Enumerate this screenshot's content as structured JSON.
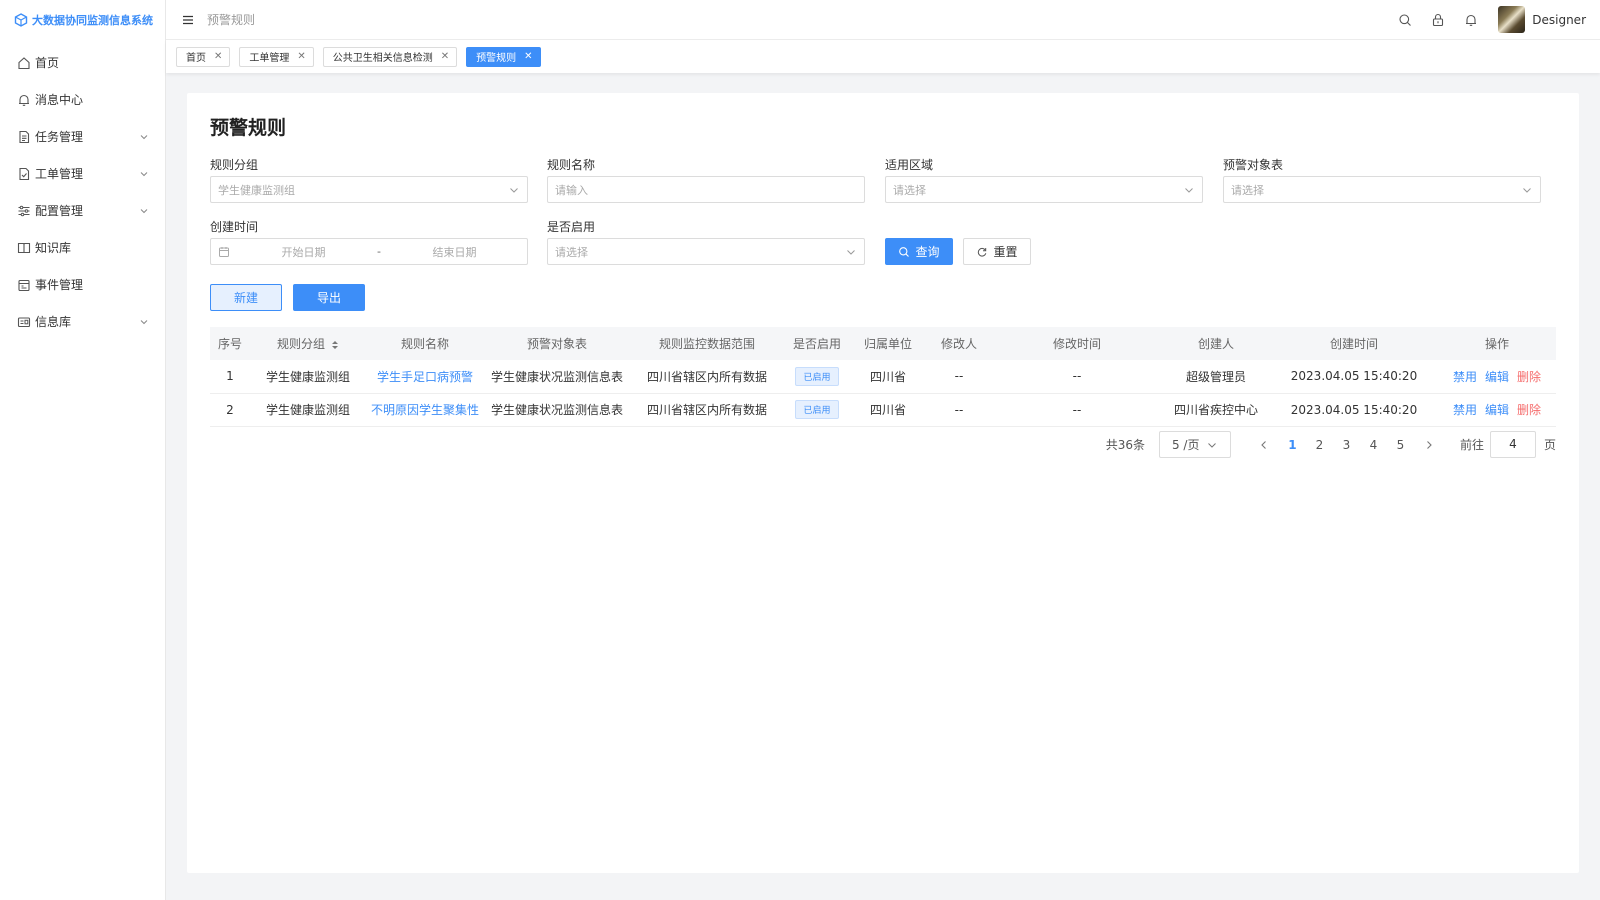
{
  "app": {
    "title": "大数据协同监测信息系统",
    "logo_icon": "cube-icon"
  },
  "sidebar": {
    "items": [
      {
        "label": "首页",
        "icon": "home-icon",
        "expandable": false
      },
      {
        "label": "消息中心",
        "icon": "bell-icon",
        "expandable": false
      },
      {
        "label": "任务管理",
        "icon": "document-icon",
        "expandable": true
      },
      {
        "label": "工单管理",
        "icon": "document-check-icon",
        "expandable": true
      },
      {
        "label": "配置管理",
        "icon": "sliders-icon",
        "expandable": true
      },
      {
        "label": "知识库",
        "icon": "book-icon",
        "expandable": false
      },
      {
        "label": "事件管理",
        "icon": "calendar-icon",
        "expandable": false
      },
      {
        "label": "信息库",
        "icon": "card-icon",
        "expandable": true
      }
    ]
  },
  "header": {
    "breadcrumb": "预警规则",
    "username": "Designer"
  },
  "tabs": [
    {
      "label": "首页",
      "active": false
    },
    {
      "label": "工单管理",
      "active": false
    },
    {
      "label": "公共卫生相关信息检测",
      "active": false
    },
    {
      "label": "预警规则",
      "active": true
    }
  ],
  "page": {
    "title": "预警规则"
  },
  "filters": {
    "group": {
      "label": "规则分组",
      "placeholder": "学生健康监测组"
    },
    "name": {
      "label": "规则名称",
      "placeholder": "请输入"
    },
    "region": {
      "label": "适用区域",
      "placeholder": "请选择"
    },
    "target": {
      "label": "预警对象表",
      "placeholder": "请选择"
    },
    "created": {
      "label": "创建时间",
      "start_placeholder": "开始日期",
      "separator": "-",
      "end_placeholder": "结束日期"
    },
    "enabled": {
      "label": "是否启用",
      "placeholder": "请选择"
    },
    "query_label": "查询",
    "reset_label": "重置"
  },
  "actions": {
    "new_label": "新建",
    "export_label": "导出"
  },
  "table": {
    "headers": [
      "序号",
      "规则分组",
      "规则名称",
      "预警对象表",
      "规则监控数据范围",
      "是否启用",
      "归属单位",
      "修改人",
      "修改时间",
      "创建人",
      "创建时间",
      "操作"
    ],
    "rows": [
      {
        "index": "1",
        "group": "学生健康监测组",
        "name": "学生手足口病预警",
        "target": "学生健康状况监测信息表",
        "scope": "四川省辖区内所有数据",
        "status": "已启用",
        "unit": "四川省",
        "modifier": "--",
        "modified": "--",
        "creator": "超级管理员",
        "created": "2023.04.05 15:40:20",
        "op_disable": "禁用",
        "op_edit": "编辑",
        "op_delete": "删除"
      },
      {
        "index": "2",
        "group": "学生健康监测组",
        "name": "不明原因学生聚集性",
        "target": "学生健康状况监测信息表",
        "scope": "四川省辖区内所有数据",
        "status": "已启用",
        "unit": "四川省",
        "modifier": "--",
        "modified": "--",
        "creator": "四川省疾控中心",
        "created": "2023.04.05 15:40:20",
        "op_disable": "禁用",
        "op_edit": "编辑",
        "op_delete": "删除"
      }
    ]
  },
  "pagination": {
    "total": "共36条",
    "page_size": "5 /页",
    "pages": [
      "1",
      "2",
      "3",
      "4",
      "5"
    ],
    "current": "1",
    "goto_label": "前往",
    "goto_value": "4",
    "page_unit": "页"
  },
  "colors": {
    "primary": "#3d8ef8",
    "danger": "#f56c6c"
  }
}
